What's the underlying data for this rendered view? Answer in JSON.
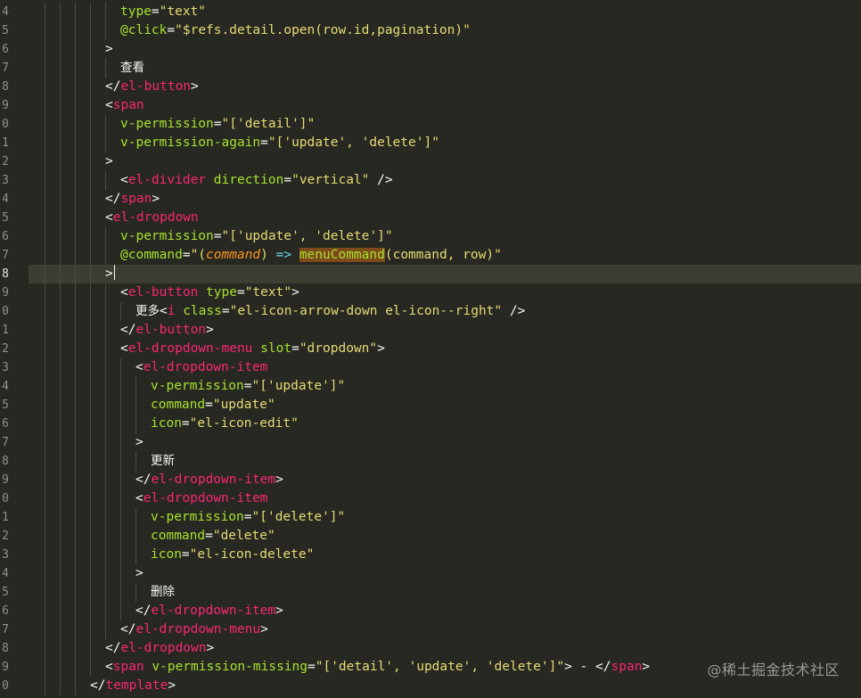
{
  "editor": {
    "theme": "monokai",
    "colors": {
      "background": "#272822",
      "tag": "#f92672",
      "attribute": "#a6e22e",
      "string": "#e6db74",
      "text": "#f8f8f2",
      "parameter": "#fd971f",
      "keyword": "#66d9ef",
      "line_highlight": "#3e3d32",
      "gutter_text": "#90908a"
    },
    "current_line_index": 14
  },
  "gutter": {
    "line_numbers": [
      "4",
      "5",
      "6",
      "7",
      "8",
      "9",
      "0",
      "1",
      "2",
      "3",
      "4",
      "5",
      "6",
      "7",
      "8",
      "9",
      "0",
      "1",
      "2",
      "3",
      "4",
      "5",
      "6",
      "7",
      "8",
      "9",
      "0",
      "1",
      "2",
      "3",
      "4",
      "5",
      "6",
      "7",
      "8",
      "9",
      "0"
    ]
  },
  "code": {
    "lines": [
      {
        "indent": 6,
        "tokens": [
          [
            "attr",
            "type"
          ],
          [
            "punc",
            "="
          ],
          [
            "str",
            "\"text\""
          ]
        ]
      },
      {
        "indent": 6,
        "tokens": [
          [
            "attr",
            "@click"
          ],
          [
            "punc",
            "="
          ],
          [
            "str",
            "\"$refs.detail.open(row.id,pagination)\""
          ]
        ]
      },
      {
        "indent": 5,
        "tokens": [
          [
            "punc",
            ">"
          ]
        ]
      },
      {
        "indent": 6,
        "tokens": [
          [
            "cjk",
            "查看"
          ]
        ]
      },
      {
        "indent": 5,
        "tokens": [
          [
            "punc",
            "</"
          ],
          [
            "tag",
            "el-button"
          ],
          [
            "punc",
            ">"
          ]
        ]
      },
      {
        "indent": 5,
        "tokens": [
          [
            "punc",
            "<"
          ],
          [
            "tag",
            "span"
          ]
        ]
      },
      {
        "indent": 6,
        "tokens": [
          [
            "attr",
            "v-permission"
          ],
          [
            "punc",
            "="
          ],
          [
            "str",
            "\"['detail']\""
          ]
        ]
      },
      {
        "indent": 6,
        "tokens": [
          [
            "attr",
            "v-permission-again"
          ],
          [
            "punc",
            "="
          ],
          [
            "str",
            "\"['update', 'delete']\""
          ]
        ]
      },
      {
        "indent": 5,
        "tokens": [
          [
            "punc",
            ">"
          ]
        ]
      },
      {
        "indent": 6,
        "tokens": [
          [
            "punc",
            "<"
          ],
          [
            "tag",
            "el-divider"
          ],
          [
            "txt",
            " "
          ],
          [
            "attr",
            "direction"
          ],
          [
            "punc",
            "="
          ],
          [
            "str",
            "\"vertical\""
          ],
          [
            "txt",
            " "
          ],
          [
            "punc",
            "/>"
          ]
        ]
      },
      {
        "indent": 5,
        "tokens": [
          [
            "punc",
            "</"
          ],
          [
            "tag",
            "span"
          ],
          [
            "punc",
            ">"
          ]
        ]
      },
      {
        "indent": 5,
        "tokens": [
          [
            "punc",
            "<"
          ],
          [
            "tag",
            "el-dropdown"
          ]
        ]
      },
      {
        "indent": 6,
        "tokens": [
          [
            "attr",
            "v-permission"
          ],
          [
            "punc",
            "="
          ],
          [
            "str",
            "\"['update', 'delete']\""
          ]
        ]
      },
      {
        "indent": 6,
        "tokens": [
          [
            "attr",
            "@command"
          ],
          [
            "punc",
            "="
          ],
          [
            "str",
            "\"("
          ],
          [
            "param",
            "command"
          ],
          [
            "str",
            ") "
          ],
          [
            "kw",
            "=>"
          ],
          [
            "str",
            " "
          ],
          [
            "fnhl",
            "menuCommand"
          ],
          [
            "str",
            "(command, row)\""
          ]
        ]
      },
      {
        "indent": 5,
        "tokens": [
          [
            "punc",
            ">"
          ]
        ],
        "cursor": true
      },
      {
        "indent": 6,
        "tokens": [
          [
            "punc",
            "<"
          ],
          [
            "tag",
            "el-button"
          ],
          [
            "txt",
            " "
          ],
          [
            "attr",
            "type"
          ],
          [
            "punc",
            "="
          ],
          [
            "str",
            "\"text\""
          ],
          [
            "punc",
            ">"
          ]
        ]
      },
      {
        "indent": 7,
        "guides": 7,
        "tokens": [
          [
            "cjk",
            "更多"
          ],
          [
            "punc",
            "<"
          ],
          [
            "tag",
            "i"
          ],
          [
            "txt",
            " "
          ],
          [
            "attr",
            "class"
          ],
          [
            "punc",
            "="
          ],
          [
            "str",
            "\"el-icon-arrow-down el-icon--right\""
          ],
          [
            "txt",
            " "
          ],
          [
            "punc",
            "/>"
          ]
        ]
      },
      {
        "indent": 6,
        "tokens": [
          [
            "punc",
            "</"
          ],
          [
            "tag",
            "el-button"
          ],
          [
            "punc",
            ">"
          ]
        ]
      },
      {
        "indent": 6,
        "tokens": [
          [
            "punc",
            "<"
          ],
          [
            "tag",
            "el-dropdown-menu"
          ],
          [
            "txt",
            " "
          ],
          [
            "attr",
            "slot"
          ],
          [
            "punc",
            "="
          ],
          [
            "str",
            "\"dropdown\""
          ],
          [
            "punc",
            ">"
          ]
        ]
      },
      {
        "indent": 7,
        "tokens": [
          [
            "punc",
            "<"
          ],
          [
            "tag",
            "el-dropdown-item"
          ]
        ]
      },
      {
        "indent": 8,
        "tokens": [
          [
            "attr",
            "v-permission"
          ],
          [
            "punc",
            "="
          ],
          [
            "str",
            "\"['update']\""
          ]
        ]
      },
      {
        "indent": 8,
        "tokens": [
          [
            "attr",
            "command"
          ],
          [
            "punc",
            "="
          ],
          [
            "str",
            "\"update\""
          ]
        ]
      },
      {
        "indent": 8,
        "tokens": [
          [
            "attr",
            "icon"
          ],
          [
            "punc",
            "="
          ],
          [
            "str",
            "\"el-icon-edit\""
          ]
        ]
      },
      {
        "indent": 7,
        "tokens": [
          [
            "punc",
            ">"
          ]
        ]
      },
      {
        "indent": 8,
        "tokens": [
          [
            "cjk",
            "更新"
          ]
        ]
      },
      {
        "indent": 7,
        "tokens": [
          [
            "punc",
            "</"
          ],
          [
            "tag",
            "el-dropdown-item"
          ],
          [
            "punc",
            ">"
          ]
        ]
      },
      {
        "indent": 7,
        "tokens": [
          [
            "punc",
            "<"
          ],
          [
            "tag",
            "el-dropdown-item"
          ]
        ]
      },
      {
        "indent": 8,
        "tokens": [
          [
            "attr",
            "v-permission"
          ],
          [
            "punc",
            "="
          ],
          [
            "str",
            "\"['delete']\""
          ]
        ]
      },
      {
        "indent": 8,
        "tokens": [
          [
            "attr",
            "command"
          ],
          [
            "punc",
            "="
          ],
          [
            "str",
            "\"delete\""
          ]
        ]
      },
      {
        "indent": 8,
        "tokens": [
          [
            "attr",
            "icon"
          ],
          [
            "punc",
            "="
          ],
          [
            "str",
            "\"el-icon-delete\""
          ]
        ]
      },
      {
        "indent": 7,
        "tokens": [
          [
            "punc",
            ">"
          ]
        ]
      },
      {
        "indent": 8,
        "tokens": [
          [
            "cjk",
            "删除"
          ]
        ]
      },
      {
        "indent": 7,
        "tokens": [
          [
            "punc",
            "</"
          ],
          [
            "tag",
            "el-dropdown-item"
          ],
          [
            "punc",
            ">"
          ]
        ]
      },
      {
        "indent": 6,
        "tokens": [
          [
            "punc",
            "</"
          ],
          [
            "tag",
            "el-dropdown-menu"
          ],
          [
            "punc",
            ">"
          ]
        ]
      },
      {
        "indent": 5,
        "tokens": [
          [
            "punc",
            "</"
          ],
          [
            "tag",
            "el-dropdown"
          ],
          [
            "punc",
            ">"
          ]
        ]
      },
      {
        "indent": 5,
        "tokens": [
          [
            "punc",
            "<"
          ],
          [
            "tag",
            "span"
          ],
          [
            "txt",
            " "
          ],
          [
            "attr",
            "v-permission-missing"
          ],
          [
            "punc",
            "="
          ],
          [
            "str",
            "\"['detail', 'update', 'delete']\""
          ],
          [
            "punc",
            ">"
          ],
          [
            "txt",
            " - "
          ],
          [
            "punc",
            "</"
          ],
          [
            "tag",
            "span"
          ],
          [
            "punc",
            ">"
          ]
        ]
      },
      {
        "indent": 4,
        "tokens": [
          [
            "punc",
            "</"
          ],
          [
            "tag",
            "template"
          ],
          [
            "punc",
            ">"
          ]
        ]
      }
    ]
  },
  "watermark": {
    "text": "@稀土掘金技术社区"
  }
}
